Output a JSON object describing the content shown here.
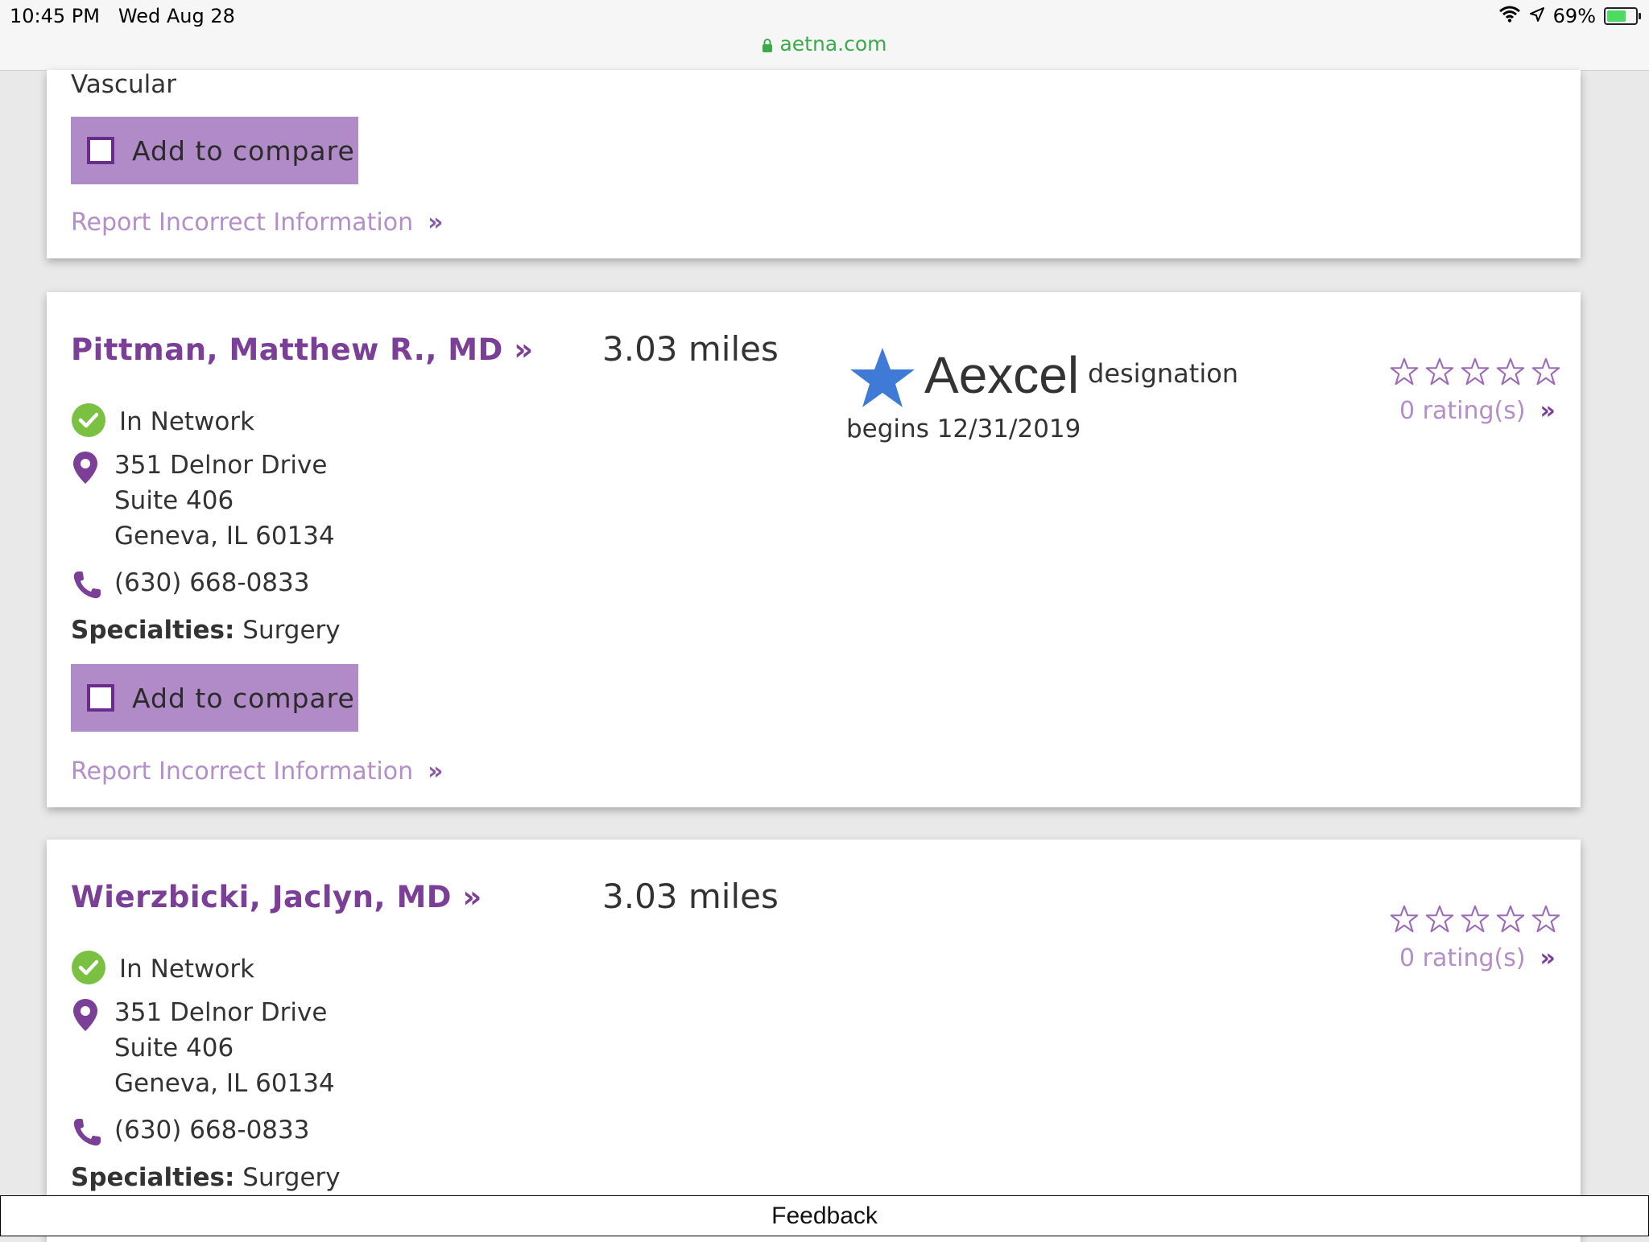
{
  "status_bar": {
    "time": "10:45 PM",
    "date": "Wed Aug 28",
    "url": "aetna.com",
    "battery": "69%",
    "battery_level": 0.69
  },
  "card1": {
    "specialty_tail": "Vascular",
    "compare_label": "Add to compare",
    "report_label": "Report Incorrect Information",
    "chevron": "»"
  },
  "card2": {
    "name": "Pittman, Matthew R., MD »",
    "distance": "3.03 miles",
    "network": "In Network",
    "address": [
      "351 Delnor Drive",
      "Suite 406",
      "Geneva, IL 60134"
    ],
    "phone": "(630) 668-0833",
    "specialties_label": "Specialties:",
    "specialties_value": "Surgery",
    "compare_label": "Add to compare",
    "report_label": "Report Incorrect Information",
    "chevron": "»",
    "aexcel_word": "Aexcel",
    "aexcel_designation": "designation",
    "aexcel_begins": "begins 12/31/2019",
    "ratings": "0 rating(s)",
    "star_rating": 0
  },
  "card3": {
    "name": "Wierzbicki, Jaclyn, MD »",
    "distance": "3.03 miles",
    "network": "In Network",
    "address": [
      "351 Delnor Drive",
      "Suite 406",
      "Geneva, IL 60134"
    ],
    "phone": "(630) 668-0833",
    "specialties_label": "Specialties:",
    "specialties_value": "Surgery",
    "ratings": "0 rating(s)",
    "star_rating": 0,
    "chevron": "»"
  },
  "feedback": "Feedback",
  "colors": {
    "brand_purple": "#7b3f98",
    "button_purple": "#b18bc8",
    "link_lilac": "#b48ec8",
    "in_network_green": "#7ac142",
    "aexcel_star_blue": "#3f7ad6",
    "url_green": "#3aaa4a"
  }
}
